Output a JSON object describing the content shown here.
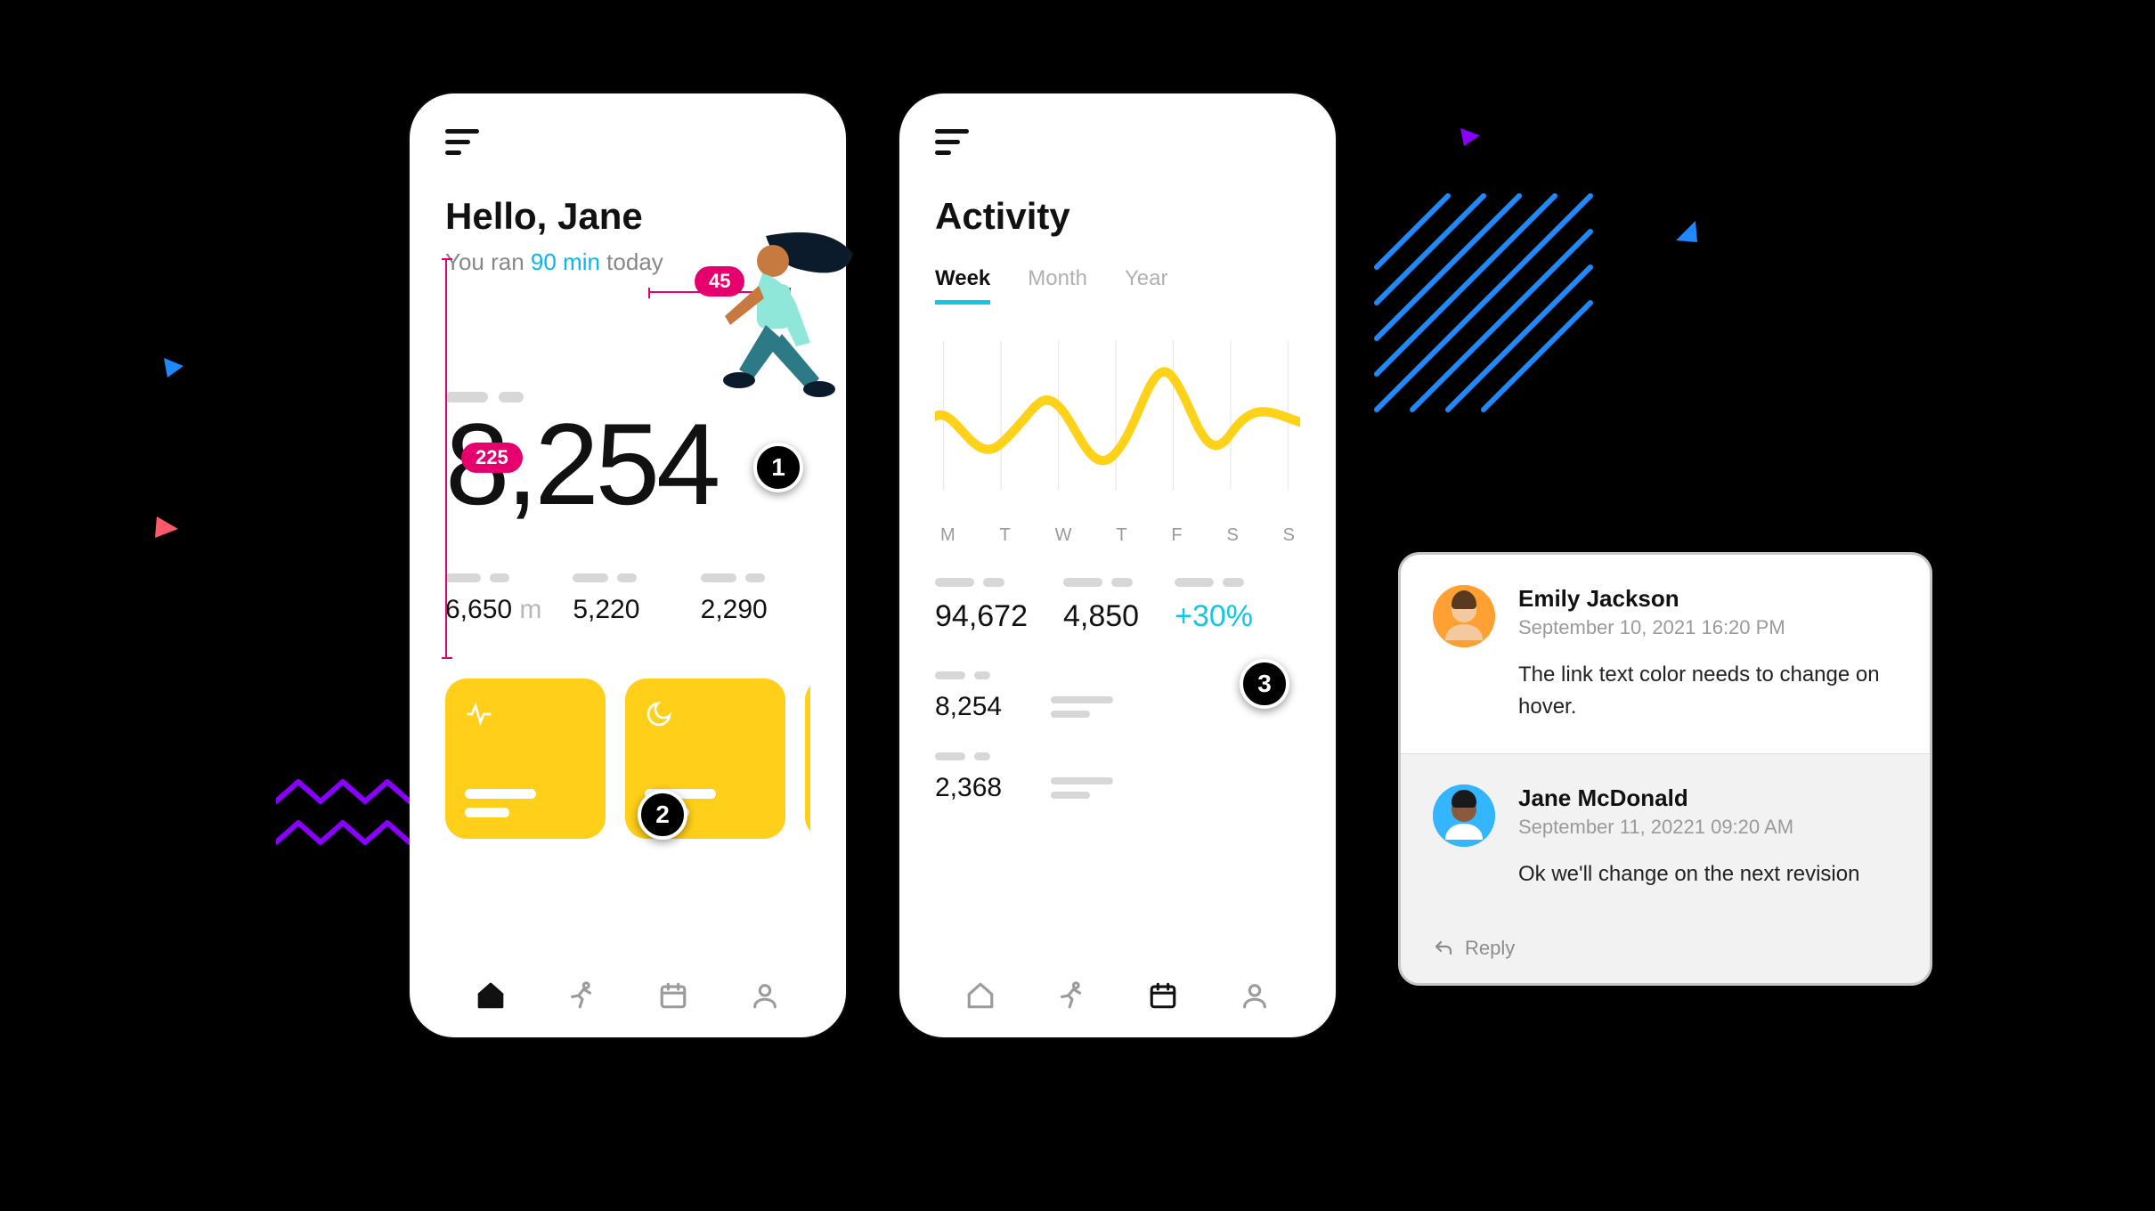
{
  "annotations": {
    "pill_45": "45",
    "pill_225": "225",
    "callout_1": "1",
    "callout_2": "2",
    "callout_3": "3"
  },
  "phone1": {
    "greeting": "Hello, Jane",
    "sub_pre": "You ran ",
    "sub_hl": "90 min",
    "sub_post": " today",
    "big_number": "8,254",
    "stats": [
      {
        "value": "6,650",
        "unit": "m"
      },
      {
        "value": "5,220",
        "unit": ""
      },
      {
        "value": "2,290",
        "unit": ""
      }
    ]
  },
  "phone2": {
    "title": "Activity",
    "tabs": {
      "week": "Week",
      "month": "Month",
      "year": "Year"
    },
    "days": [
      "M",
      "T",
      "W",
      "T",
      "F",
      "S",
      "S"
    ],
    "metrics": [
      {
        "value": "94,672"
      },
      {
        "value": "4,850"
      },
      {
        "value": "+30%",
        "delta": true
      }
    ],
    "list": [
      {
        "value": "8,254"
      },
      {
        "value": "2,368"
      }
    ]
  },
  "comments": {
    "c1": {
      "name": "Emily Jackson",
      "date": "September 10, 2021 16:20 PM",
      "text": "The link text color needs to change on hover."
    },
    "c2": {
      "name": "Jane McDonald",
      "date": "September 11, 20221 09:20 AM",
      "text": "Ok we'll change on the next revision"
    },
    "reply_label": "Reply"
  },
  "chart_data": {
    "type": "line",
    "categories": [
      "M",
      "T",
      "W",
      "T",
      "F",
      "S",
      "S"
    ],
    "values": [
      55,
      35,
      60,
      30,
      75,
      40,
      48
    ],
    "ylim": [
      0,
      100
    ],
    "title": "Activity",
    "xlabel": "",
    "ylabel": ""
  }
}
